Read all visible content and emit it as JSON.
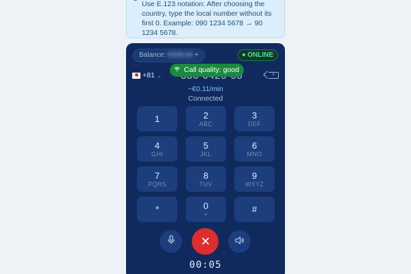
{
  "info": {
    "text": "Use E.123 notation: After choosing the country, type the local number without its first 0. Example: 090 1234 5678 → 90 1234 5678."
  },
  "dialer": {
    "balance_label": "Balance:",
    "balance_value": "€329.04",
    "balance_add": "+",
    "online_label": "ONLINE",
    "tooltip": "Call quality: good",
    "country_code": "+81",
    "number": "336-0420-00",
    "rate": "~€0.11/min",
    "status": "Connected",
    "timer": "00:05"
  },
  "keypad": [
    {
      "digit": "1",
      "letters": ""
    },
    {
      "digit": "2",
      "letters": "ABC"
    },
    {
      "digit": "3",
      "letters": "DEF"
    },
    {
      "digit": "4",
      "letters": "GHI"
    },
    {
      "digit": "5",
      "letters": "JKL"
    },
    {
      "digit": "6",
      "letters": "MNO"
    },
    {
      "digit": "7",
      "letters": "PQRS"
    },
    {
      "digit": "8",
      "letters": "TUV"
    },
    {
      "digit": "9",
      "letters": "WXYZ"
    },
    {
      "digit": "*",
      "letters": ""
    },
    {
      "digit": "0",
      "letters": "+"
    },
    {
      "digit": "#",
      "letters": ""
    }
  ],
  "icons": {
    "info": "info-icon",
    "wifi": "wifi-icon",
    "backspace": "backspace-icon",
    "mic": "microphone-icon",
    "hangup": "hangup-icon",
    "speaker": "speaker-icon"
  },
  "colors": {
    "panel": "#102a5e",
    "key": "#1c3e7d",
    "online": "#4ee38f",
    "hangup": "#dd2d2d",
    "tooltip": "#1b8a3e"
  }
}
